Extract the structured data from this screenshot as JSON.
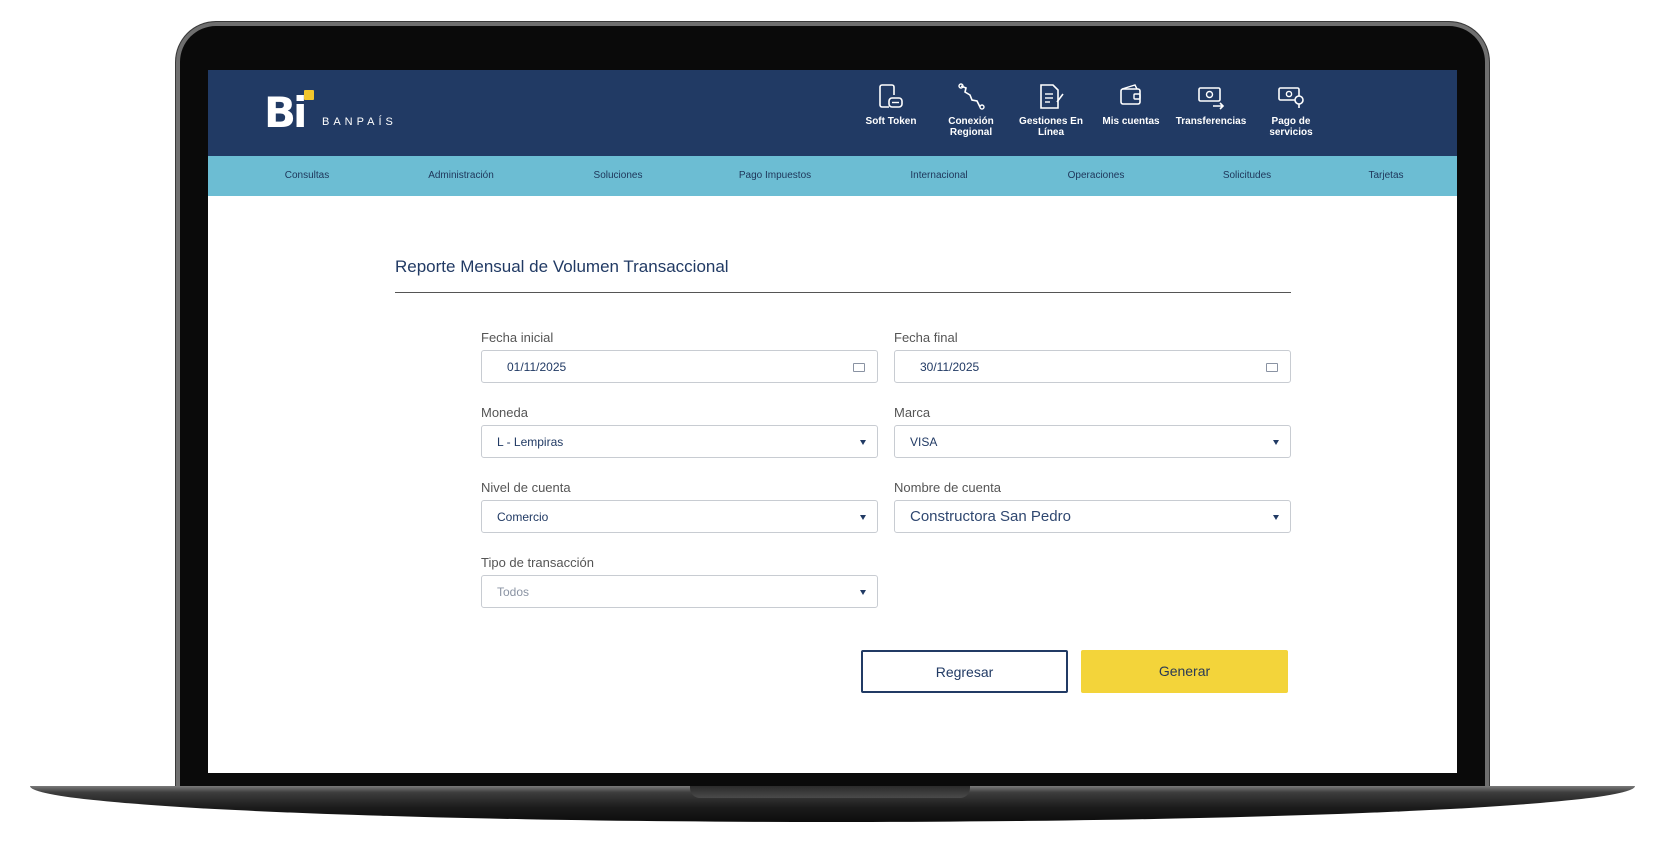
{
  "brand": {
    "logo_mark": "Bi",
    "logo_text": "BANPAÍS",
    "accent": "#f2c62c",
    "header_color": "#213a64",
    "nav_color": "#6cbdd3"
  },
  "quick_access": [
    {
      "label": "Soft Token",
      "icon": "soft-token-icon"
    },
    {
      "label": "Conexión Regional",
      "icon": "regional-connection-icon"
    },
    {
      "label": "Gestiones En Línea",
      "icon": "online-document-icon"
    },
    {
      "label": "Mis cuentas",
      "icon": "wallet-icon"
    },
    {
      "label": "Transferencias",
      "icon": "transfer-icon"
    },
    {
      "label": "Pago de servicios",
      "icon": "bill-payment-icon"
    }
  ],
  "nav": [
    "Consultas",
    "Administración",
    "Soluciones",
    "Pago Impuestos",
    "Internacional",
    "Operaciones",
    "Solicitudes",
    "Tarjetas"
  ],
  "page": {
    "title": "Reporte Mensual de Volumen Transaccional"
  },
  "form": {
    "fecha_inicial": {
      "label": "Fecha inicial",
      "value": "01/11/2025"
    },
    "fecha_final": {
      "label": "Fecha final",
      "value": "30/11/2025"
    },
    "moneda": {
      "label": "Moneda",
      "value": "L - Lempiras"
    },
    "marca": {
      "label": "Marca",
      "value": "VISA"
    },
    "nivel_cuenta": {
      "label": "Nivel de cuenta",
      "value": "Comercio"
    },
    "nombre_cuenta": {
      "label": "Nombre de cuenta",
      "value": "Constructora San Pedro"
    },
    "tipo_transaccion": {
      "label": "Tipo de transacción",
      "placeholder": "Todos"
    }
  },
  "actions": {
    "back": "Regresar",
    "generate": "Generar",
    "generate_color": "#f3d43a"
  }
}
